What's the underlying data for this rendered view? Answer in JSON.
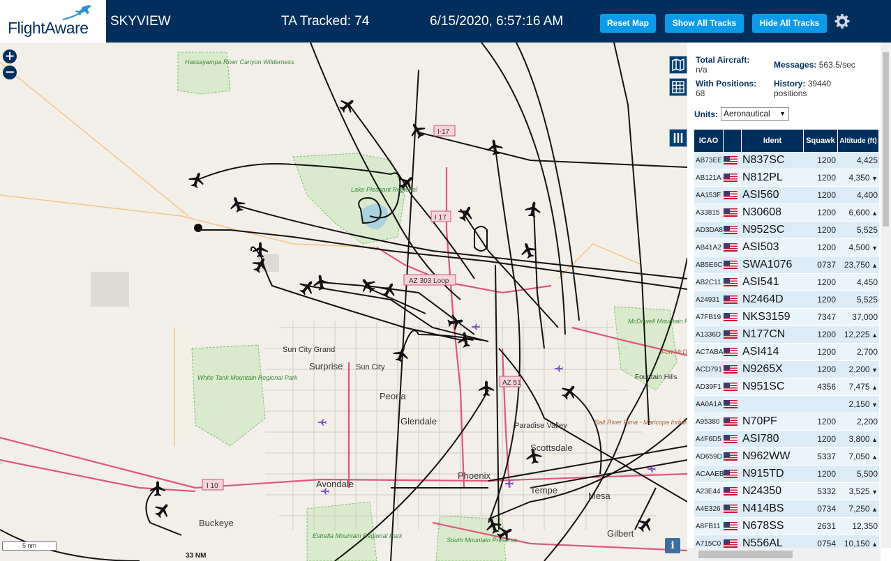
{
  "header": {
    "logo_text": "FlightAware",
    "app_name": "SKYVIEW",
    "tracked": "TA Tracked: 74",
    "datetime": "6/15/2020, 6:57:16 AM",
    "buttons": {
      "reset": "Reset Map",
      "show": "Show All Tracks",
      "hide": "Hide All Tracks"
    }
  },
  "map": {
    "zoom_in": "+",
    "zoom_out": "−",
    "scale": "5 nm",
    "scale_distance": "33 NM",
    "info": "i",
    "places": [
      {
        "name": "Hassayampa River Canyon Wilderness",
        "park": true
      },
      {
        "name": "Lake Pleasant Regional",
        "park": true
      },
      {
        "name": "White Tank Mountain Regional Park",
        "park": true
      },
      {
        "name": "McDowell Mountain Regional Park",
        "park": true
      },
      {
        "name": "Estrella Mountain Regional Park",
        "park": true
      },
      {
        "name": "South Mountain Preserve",
        "park": true
      },
      {
        "name": "Salt River Pima - Maricopa Indian Community",
        "park": false
      },
      {
        "name": "Sun City Grand"
      },
      {
        "name": "Surprise"
      },
      {
        "name": "Sun City"
      },
      {
        "name": "Peoria"
      },
      {
        "name": "Glendale"
      },
      {
        "name": "Paradise Valley"
      },
      {
        "name": "Scottsdale"
      },
      {
        "name": "Phoenix"
      },
      {
        "name": "Avondale"
      },
      {
        "name": "Tempe"
      },
      {
        "name": "Mesa"
      },
      {
        "name": "Buckeye"
      },
      {
        "name": "Gilbert"
      },
      {
        "name": "Fountain Hills"
      },
      {
        "name": "Fort McDowell Yavapai Nation"
      }
    ],
    "shields": [
      "I-17",
      "I 17",
      "AZ 303 Loop",
      "AZ 51",
      "I 10"
    ]
  },
  "sidebar": {
    "total_label": "Total Aircraft:",
    "total_value": "n/a",
    "messages_label": "Messages:",
    "messages_value": "563.5/sec",
    "with_pos_label": "With Positions:",
    "with_pos_value": "68",
    "history_label": "History:",
    "history_value": "39440 positions",
    "units_label": "Units:",
    "units_value": "Aeronautical",
    "columns": {
      "icao": "ICAO",
      "ident": "Ident",
      "squawk": "Squawk",
      "altitude": "Altitude (ft)"
    },
    "rows": [
      {
        "icao": "AB73EE",
        "ident": "N837SC",
        "squawk": "1200",
        "alt": "4,425",
        "trend": ""
      },
      {
        "icao": "AB121A",
        "ident": "N812PL",
        "squawk": "1200",
        "alt": "4,350",
        "trend": "down"
      },
      {
        "icao": "AA153F",
        "ident": "ASI560",
        "squawk": "1200",
        "alt": "4,400",
        "trend": ""
      },
      {
        "icao": "A33815",
        "ident": "N30608",
        "squawk": "1200",
        "alt": "6,600",
        "trend": "up"
      },
      {
        "icao": "AD3DA8",
        "ident": "N952SC",
        "squawk": "1200",
        "alt": "5,525",
        "trend": ""
      },
      {
        "icao": "AB41A2",
        "ident": "ASI503",
        "squawk": "1200",
        "alt": "4,500",
        "trend": "down"
      },
      {
        "icao": "AB5E6C",
        "ident": "SWA1076",
        "squawk": "0737",
        "alt": "23,750",
        "trend": "up"
      },
      {
        "icao": "AB2C11",
        "ident": "ASI541",
        "squawk": "1200",
        "alt": "4,450",
        "trend": ""
      },
      {
        "icao": "A24931",
        "ident": "N2464D",
        "squawk": "1200",
        "alt": "5,525",
        "trend": ""
      },
      {
        "icao": "A7FB19",
        "ident": "NKS3159",
        "squawk": "7347",
        "alt": "37,000",
        "trend": ""
      },
      {
        "icao": "A1336D",
        "ident": "N177CN",
        "squawk": "1200",
        "alt": "12,225",
        "trend": "up"
      },
      {
        "icao": "AC7ABA",
        "ident": "ASI414",
        "squawk": "1200",
        "alt": "2,700",
        "trend": ""
      },
      {
        "icao": "ACD791",
        "ident": "N9265X",
        "squawk": "1200",
        "alt": "2,200",
        "trend": "down"
      },
      {
        "icao": "AD39F1",
        "ident": "N951SC",
        "squawk": "4356",
        "alt": "7,475",
        "trend": "up"
      },
      {
        "icao": "AA0A1A",
        "ident": "",
        "squawk": "",
        "alt": "2,150",
        "trend": "down"
      },
      {
        "icao": "A95380",
        "ident": "N70PF",
        "squawk": "1200",
        "alt": "2,200",
        "trend": ""
      },
      {
        "icao": "A4F6D5",
        "ident": "ASI780",
        "squawk": "1200",
        "alt": "3,800",
        "trend": "up"
      },
      {
        "icao": "AD659D",
        "ident": "N962WW",
        "squawk": "5337",
        "alt": "7,050",
        "trend": "up"
      },
      {
        "icao": "ACAAEB",
        "ident": "N915TD",
        "squawk": "1200",
        "alt": "5,500",
        "trend": ""
      },
      {
        "icao": "A23E44",
        "ident": "N24350",
        "squawk": "5332",
        "alt": "3,525",
        "trend": "down"
      },
      {
        "icao": "A4E326",
        "ident": "N414BS",
        "squawk": "0734",
        "alt": "7,250",
        "trend": "up"
      },
      {
        "icao": "A8FB11",
        "ident": "N678SS",
        "squawk": "2631",
        "alt": "12,350",
        "trend": ""
      },
      {
        "icao": "A715C0",
        "ident": "N556AL",
        "squawk": "0754",
        "alt": "10,150",
        "trend": "up"
      }
    ]
  },
  "colors": {
    "header": "#002f5d",
    "button": "#0a9cea",
    "map_bg": "#f2efe9",
    "park": "#d6e8c7",
    "road": "#e0567a",
    "track": "#111111"
  }
}
